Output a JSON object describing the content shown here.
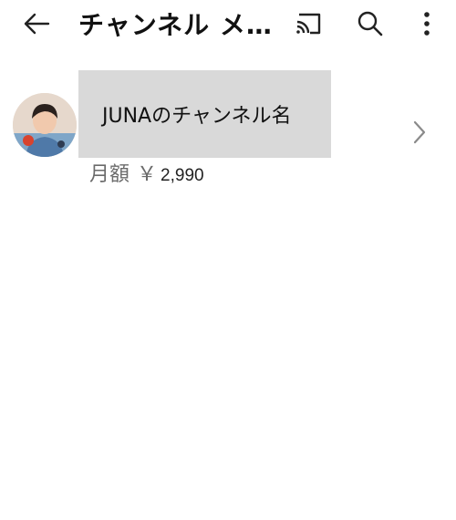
{
  "appbar": {
    "title": "チャンネル メ…",
    "back_icon": "arrow-left-icon",
    "cast_icon": "cast-icon",
    "search_icon": "search-icon",
    "more_icon": "more-vert-icon"
  },
  "channel": {
    "name": "JUNAのチャンネル名",
    "price_label": "月額",
    "price_currency": "￥",
    "price_value": "2,990",
    "chevron_icon": "chevron-right-icon"
  },
  "colors": {
    "name_box_bg": "#d9d9d9",
    "price_label": "#6b6b6b",
    "icon": "#222222"
  }
}
